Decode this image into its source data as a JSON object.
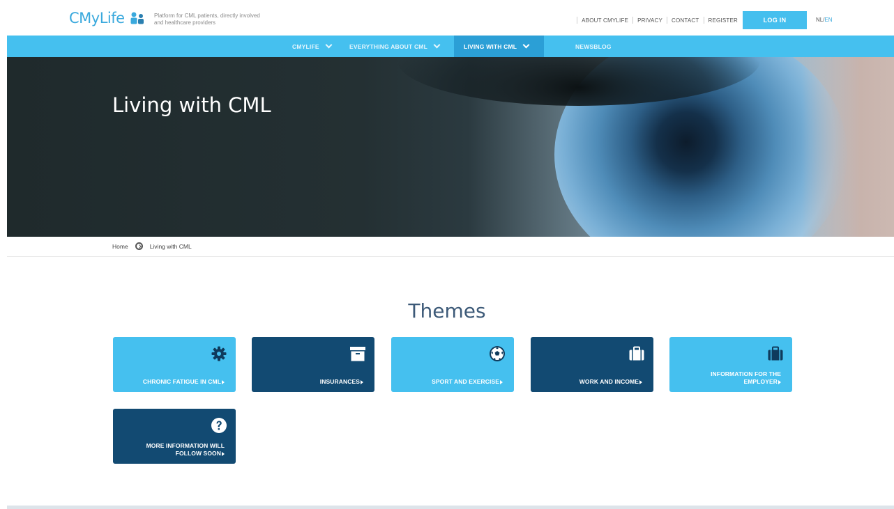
{
  "header": {
    "logo_text": "CMyLife",
    "tagline": "Platform for CML patients, directly involved and healthcare providers",
    "util_links": [
      "ABOUT CMYLIFE",
      "PRIVACY",
      "CONTACT",
      "REGISTER"
    ],
    "login_label": "LOG IN",
    "lang_nl": "NL",
    "lang_slash": "/",
    "lang_en": "EN"
  },
  "nav": {
    "items": [
      {
        "label": "CMYLIFE",
        "has_dropdown": true
      },
      {
        "label": "EVERYTHING ABOUT CML",
        "has_dropdown": true
      },
      {
        "label": "LIVING WITH CML",
        "has_dropdown": true,
        "active": true
      },
      {
        "label": "NEWSBLOG",
        "has_dropdown": false
      }
    ]
  },
  "hero": {
    "title": "Living with CML"
  },
  "breadcrumb": {
    "home": "Home",
    "current": "Living with CML"
  },
  "themes": {
    "title": "Themes",
    "tiles": [
      {
        "label": "CHRONIC FATIGUE IN CML",
        "icon": "gear-icon",
        "style": "light"
      },
      {
        "label": "INSURANCES",
        "icon": "archive-box-icon",
        "style": "dark"
      },
      {
        "label": "SPORT AND EXERCISE",
        "icon": "soccer-ball-icon",
        "style": "light"
      },
      {
        "label": "WORK AND INCOME",
        "icon": "briefcase-icon",
        "style": "dark"
      },
      {
        "label": "INFORMATION FOR THE EMPLOYER",
        "icon": "briefcase-icon",
        "style": "light"
      },
      {
        "label": "MORE INFORMATION WILL FOLLOW SOON",
        "icon": "question-icon",
        "style": "dark"
      }
    ]
  },
  "colors": {
    "accent": "#45c0ef",
    "active_nav": "#2b9fd6",
    "dark_tile": "#124a72",
    "title": "#3d5a78"
  }
}
